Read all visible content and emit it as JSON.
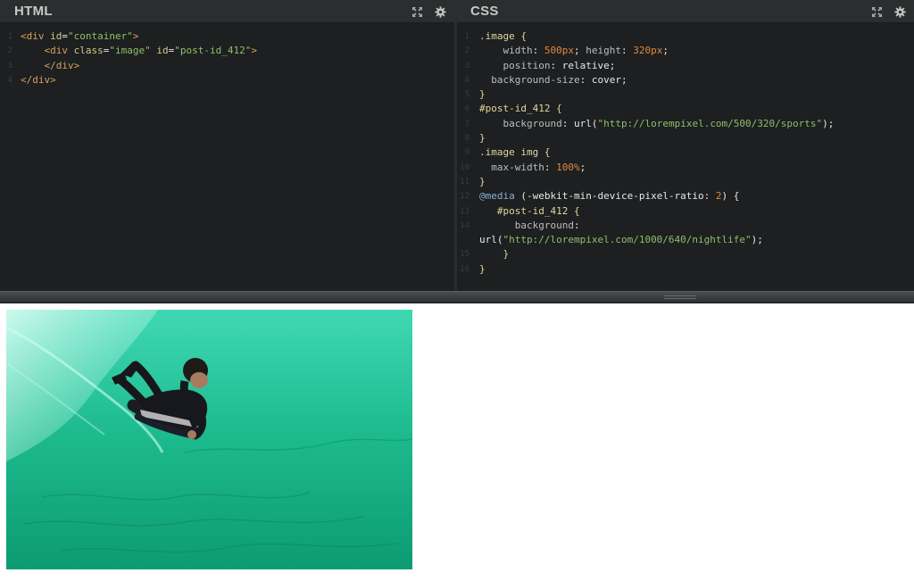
{
  "html_pane": {
    "title": "HTML",
    "lines": [
      {
        "n": "1",
        "t": [
          {
            "c": "t-tag",
            "s": "<div "
          },
          {
            "c": "t-attr",
            "s": "id"
          },
          {
            "c": "t-val",
            "s": "="
          },
          {
            "c": "t-str",
            "s": "\"container\""
          },
          {
            "c": "t-tag",
            "s": ">"
          }
        ]
      },
      {
        "n": "2",
        "t": [
          {
            "c": "",
            "s": "    "
          },
          {
            "c": "t-tag",
            "s": "<div "
          },
          {
            "c": "t-attr",
            "s": "class"
          },
          {
            "c": "t-val",
            "s": "="
          },
          {
            "c": "t-str",
            "s": "\"image\""
          },
          {
            "c": "t-attr",
            "s": " id"
          },
          {
            "c": "t-val",
            "s": "="
          },
          {
            "c": "t-str",
            "s": "\"post-id_412\""
          },
          {
            "c": "t-tag",
            "s": ">"
          }
        ]
      },
      {
        "n": "3",
        "t": [
          {
            "c": "",
            "s": "    "
          },
          {
            "c": "t-tag",
            "s": "</div>"
          }
        ]
      },
      {
        "n": "4",
        "t": [
          {
            "c": "t-tag",
            "s": "</div>"
          }
        ]
      }
    ]
  },
  "css_pane": {
    "title": "CSS",
    "lines": [
      {
        "n": "1",
        "t": [
          {
            "c": "t-sel",
            "s": ".image {"
          }
        ]
      },
      {
        "n": "2",
        "t": [
          {
            "c": "",
            "s": "    "
          },
          {
            "c": "t-prop",
            "s": "width"
          },
          {
            "c": "t-val",
            "s": ": "
          },
          {
            "c": "t-num",
            "s": "500px"
          },
          {
            "c": "t-val",
            "s": "; "
          },
          {
            "c": "t-prop",
            "s": "height"
          },
          {
            "c": "t-val",
            "s": ": "
          },
          {
            "c": "t-num",
            "s": "320px"
          },
          {
            "c": "t-val",
            "s": ";"
          }
        ]
      },
      {
        "n": "3",
        "t": [
          {
            "c": "",
            "s": "    "
          },
          {
            "c": "t-prop",
            "s": "position"
          },
          {
            "c": "t-val",
            "s": ": relative;"
          }
        ]
      },
      {
        "n": "4",
        "t": [
          {
            "c": "",
            "s": "  "
          },
          {
            "c": "t-prop",
            "s": "background-size"
          },
          {
            "c": "t-val",
            "s": ": cover;"
          }
        ]
      },
      {
        "n": "5",
        "t": [
          {
            "c": "t-sel",
            "s": "}"
          }
        ]
      },
      {
        "n": "6",
        "t": [
          {
            "c": "t-sel",
            "s": "#post-id_412 {"
          }
        ]
      },
      {
        "n": "7",
        "t": [
          {
            "c": "",
            "s": "    "
          },
          {
            "c": "t-prop",
            "s": "background"
          },
          {
            "c": "t-val",
            "s": ": url("
          },
          {
            "c": "t-str",
            "s": "\"http://lorempixel.com/500/320/sports\""
          },
          {
            "c": "t-val",
            "s": ");"
          }
        ]
      },
      {
        "n": "8",
        "t": [
          {
            "c": "t-sel",
            "s": "}"
          }
        ]
      },
      {
        "n": "9",
        "t": [
          {
            "c": "t-sel",
            "s": ".image img {"
          }
        ]
      },
      {
        "n": "10",
        "t": [
          {
            "c": "",
            "s": "  "
          },
          {
            "c": "t-prop",
            "s": "max-width"
          },
          {
            "c": "t-val",
            "s": ": "
          },
          {
            "c": "t-num",
            "s": "100%"
          },
          {
            "c": "t-val",
            "s": ";"
          }
        ]
      },
      {
        "n": "11",
        "t": [
          {
            "c": "t-sel",
            "s": "}"
          }
        ]
      },
      {
        "n": "12",
        "t": [
          {
            "c": "t-kw",
            "s": "@media"
          },
          {
            "c": "t-val",
            "s": " (-webkit-min-device-pixel-ratio: "
          },
          {
            "c": "t-num",
            "s": "2"
          },
          {
            "c": "t-val",
            "s": ") {"
          }
        ]
      },
      {
        "n": "13",
        "t": [
          {
            "c": "",
            "s": "   "
          },
          {
            "c": "t-sel",
            "s": "#post-id_412 {"
          }
        ]
      },
      {
        "n": "14",
        "t": [
          {
            "c": "",
            "s": "      "
          },
          {
            "c": "t-prop",
            "s": "background"
          },
          {
            "c": "t-val",
            "s": ":"
          }
        ]
      },
      {
        "n": "",
        "t": [
          {
            "c": "t-val",
            "s": "url("
          },
          {
            "c": "t-str",
            "s": "\"http://lorempixel.com/1000/640/nightlife\""
          },
          {
            "c": "t-val",
            "s": ");"
          }
        ]
      },
      {
        "n": "15",
        "t": [
          {
            "c": "",
            "s": "    "
          },
          {
            "c": "t-sel",
            "s": "}"
          }
        ]
      },
      {
        "n": "16",
        "t": [
          {
            "c": "t-sel",
            "s": "}"
          }
        ]
      }
    ]
  },
  "icons": {
    "expand": "expand-icon",
    "gear": "gear-icon"
  },
  "colors": {
    "editor_bg": "#1d1f20",
    "header_bg": "#2b2d2e",
    "water": "#27c59a"
  }
}
